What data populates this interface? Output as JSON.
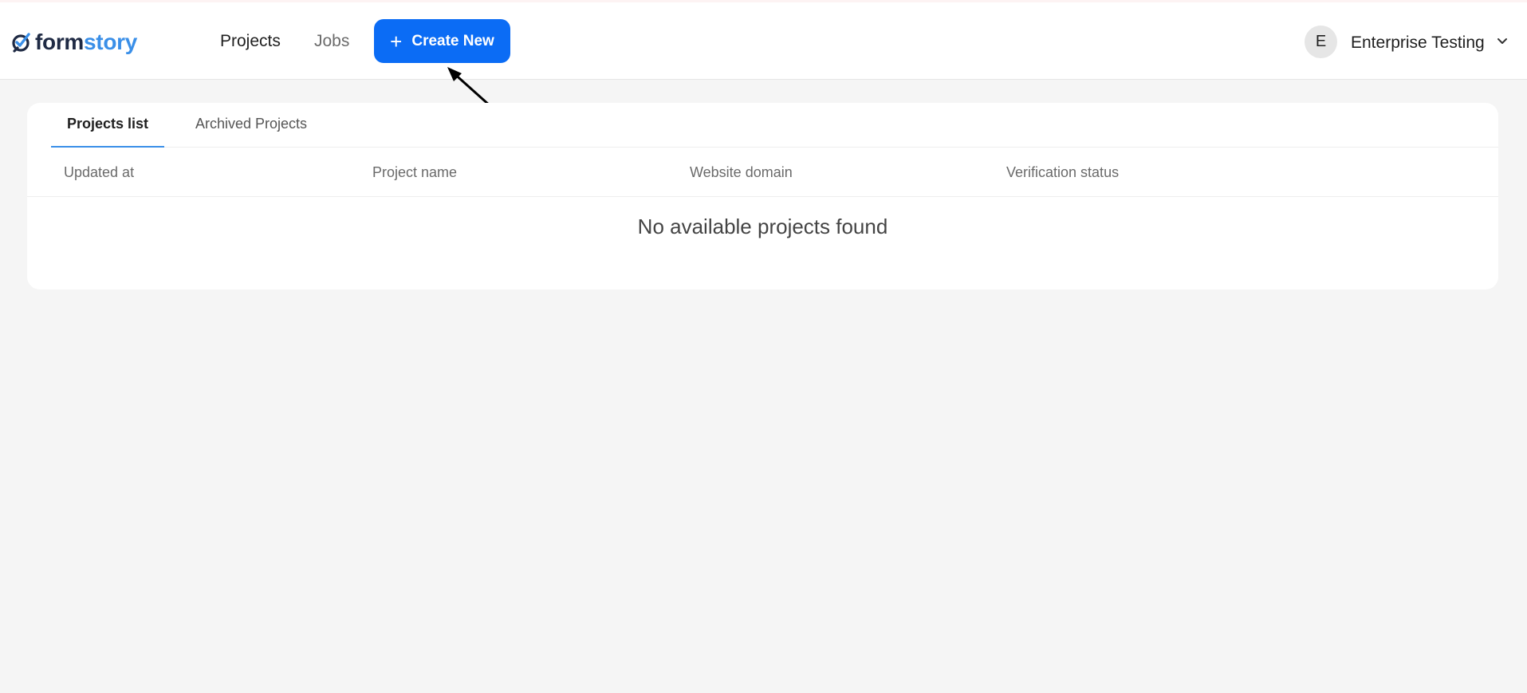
{
  "app": {
    "logo_part1": "form",
    "logo_part2": "story"
  },
  "nav": {
    "projects": "Projects",
    "jobs": "Jobs",
    "create_button": "Create New",
    "create_icon": "plus-icon"
  },
  "account": {
    "avatar_initial": "E",
    "org_name": "Enterprise Testing"
  },
  "tabs": [
    {
      "label": "Projects list",
      "active": true
    },
    {
      "label": "Archived Projects",
      "active": false
    }
  ],
  "table": {
    "columns": [
      "Updated at",
      "Project name",
      "Website domain",
      "Verification status"
    ],
    "empty_message": "No available projects found"
  },
  "colors": {
    "accent": "#0b6cf5",
    "brand": "#3a8fe8"
  }
}
